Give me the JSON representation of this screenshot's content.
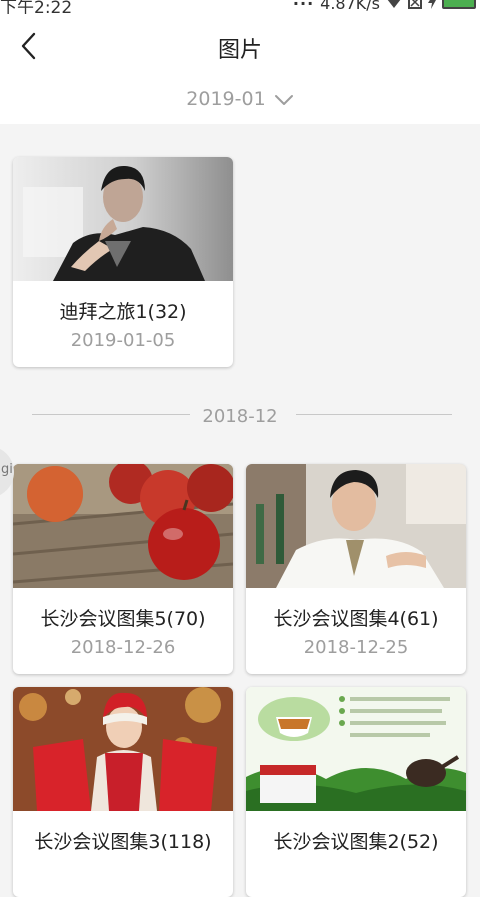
{
  "status_bar": {
    "time": "下午2:22",
    "speed": "4.87K/s"
  },
  "header": {
    "title": "图片"
  },
  "filter": {
    "selected_month": "2019-01"
  },
  "side_tab": {
    "label": "gi"
  },
  "groups": [
    {
      "month": "",
      "albums": [
        {
          "title": "迪拜之旅1(32)",
          "date": "2019-01-05",
          "photo": "man-portrait-bw-icon"
        }
      ]
    },
    {
      "month": "2018-12",
      "albums": [
        {
          "title": "长沙会议图集5(70)",
          "date": "2018-12-26",
          "photo": "apples-photo-icon"
        },
        {
          "title": "长沙会议图集4(61)",
          "date": "2018-12-25",
          "photo": "man-portrait-office-icon"
        },
        {
          "title": "长沙会议图集3(118)",
          "date": "",
          "photo": "woman-shopping-photo-icon"
        },
        {
          "title": "长沙会议图集2(52)",
          "date": "",
          "photo": "tea-product-photo-icon"
        }
      ]
    }
  ],
  "colors": {
    "accent_battery": "#4caf50",
    "muted_text": "#9e9e9e",
    "background": "#f4f4f4"
  }
}
